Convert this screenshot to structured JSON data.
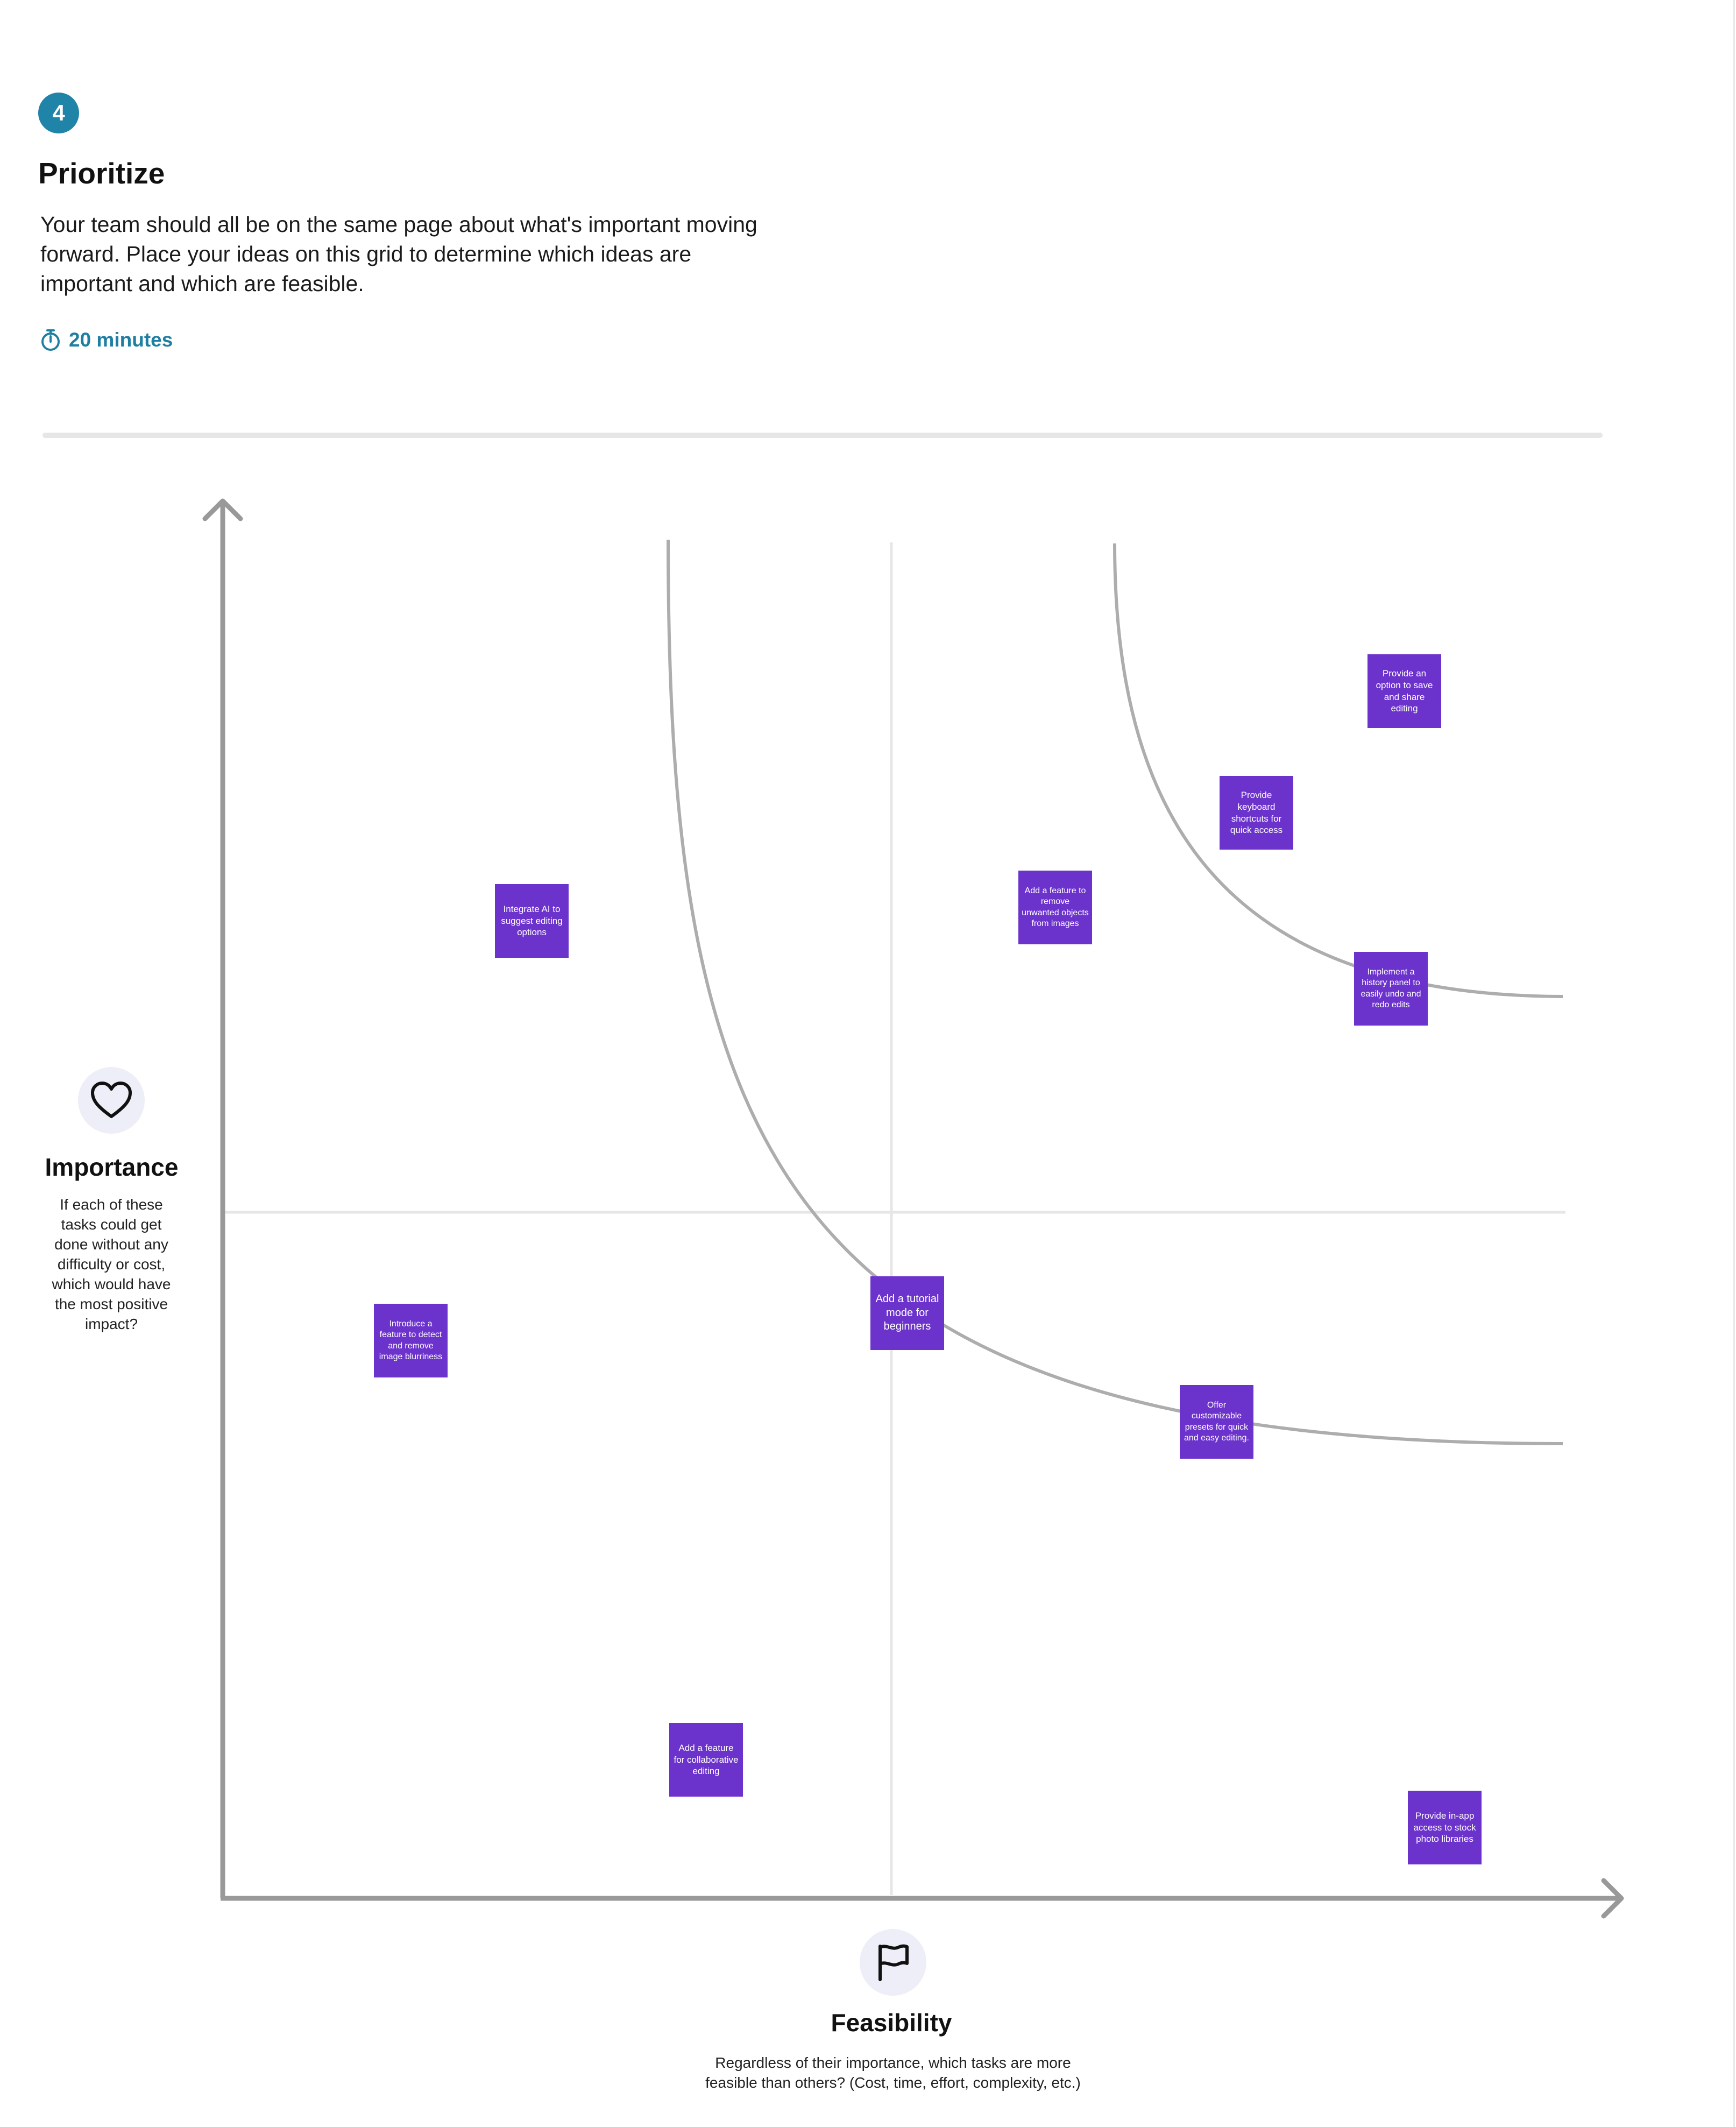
{
  "step": {
    "number": "4"
  },
  "header": {
    "title": "Prioritize",
    "description": "Your team should all be on the same page about what's important moving forward. Place your ideas on this grid to determine which ideas are important and which are feasible.",
    "timer_label": "20 minutes"
  },
  "y_axis": {
    "title": "Importance",
    "description": "If each of these tasks could get done without any difficulty or cost, which would have the most positive impact?",
    "icon": "heart-icon"
  },
  "x_axis": {
    "title": "Feasibility",
    "description": "Regardless of their importance, which tasks are more feasible than others? (Cost, time, effort, complexity, etc.)",
    "icon": "flag-icon"
  },
  "colors": {
    "accent": "#2083a8",
    "sticky_note": "#6c33cc",
    "axis": "#a0a0a0",
    "grid": "#e6e6e6"
  },
  "sticky_notes": [
    {
      "text": "Provide an option to save and share editing",
      "feasibility": 0.88,
      "importance": 0.89
    },
    {
      "text": "Provide keyboard shortcuts for quick access",
      "feasibility": 0.77,
      "importance": 0.8
    },
    {
      "text": "Add a feature to remove unwanted objects from images",
      "feasibility": 0.62,
      "importance": 0.73
    },
    {
      "text": "Integrate AI to suggest editing options",
      "feasibility": 0.23,
      "importance": 0.72
    },
    {
      "text": "Implement a history panel to easily undo and redo edits",
      "feasibility": 0.87,
      "importance": 0.67
    },
    {
      "text": "Introduce a feature to detect and remove image blurriness",
      "feasibility": 0.14,
      "importance": 0.41
    },
    {
      "text": "Add a tutorial mode for beginners",
      "feasibility": 0.51,
      "importance": 0.43
    },
    {
      "text": "Offer customizable presets for quick and easy editing.",
      "feasibility": 0.74,
      "importance": 0.35
    },
    {
      "text": "Add a feature for collaborative editing",
      "feasibility": 0.36,
      "importance": 0.1
    },
    {
      "text": "Provide in-app access to stock photo libraries",
      "feasibility": 0.91,
      "importance": 0.05
    }
  ]
}
